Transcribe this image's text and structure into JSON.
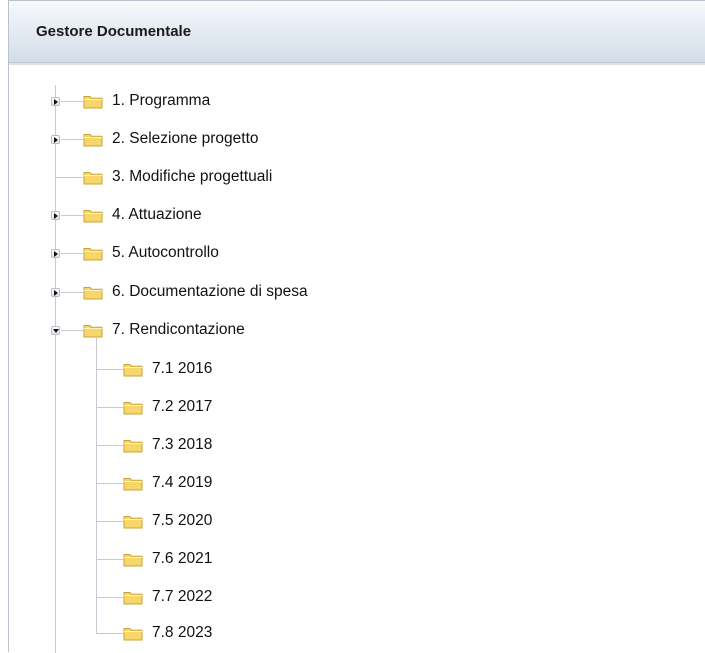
{
  "panel": {
    "title": "Gestore Documentale"
  },
  "tree": {
    "nodes": [
      {
        "label": "1. Programma",
        "expander": "collapsed"
      },
      {
        "label": "2. Selezione progetto",
        "expander": "collapsed"
      },
      {
        "label": "3. Modifiche progettuali",
        "expander": "none"
      },
      {
        "label": "4. Attuazione",
        "expander": "collapsed"
      },
      {
        "label": "5. Autocontrollo",
        "expander": "collapsed"
      },
      {
        "label": "6. Documentazione di spesa",
        "expander": "collapsed"
      },
      {
        "label": "7. Rendicontazione",
        "expander": "expanded"
      }
    ],
    "children": [
      {
        "label": "7.1 2016"
      },
      {
        "label": "7.2 2017"
      },
      {
        "label": "7.3 2018"
      },
      {
        "label": "7.4 2019"
      },
      {
        "label": "7.5 2020"
      },
      {
        "label": "7.6 2021"
      },
      {
        "label": "7.7 2022"
      },
      {
        "label": "7.8 2023"
      }
    ]
  },
  "icons": {
    "folder": "folder-icon",
    "expand": "triangle-right-icon",
    "collapse": "triangle-down-icon"
  },
  "colors": {
    "folder_fill": "#f7d66a",
    "folder_edge": "#c9a33a",
    "tree_line": "#c6ccd3"
  }
}
